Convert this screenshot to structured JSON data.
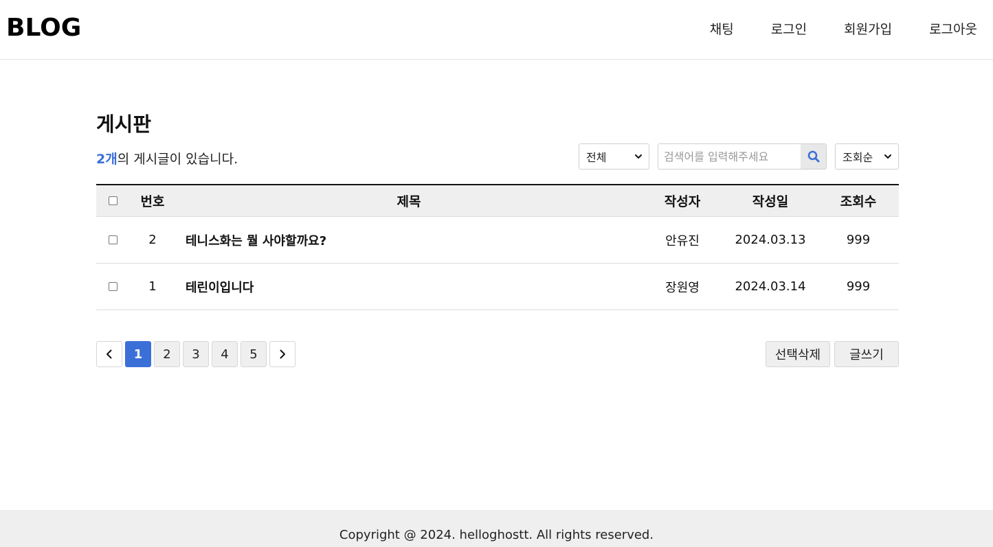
{
  "header": {
    "logo": "BLOG",
    "nav": [
      "채팅",
      "로그인",
      "회원가입",
      "로그아웃"
    ]
  },
  "board": {
    "title": "게시판",
    "count_num": "2개",
    "count_suffix": "의 게시글이 있습니다.",
    "category_select": "전체",
    "search_placeholder": "검색어를 입력해주세요",
    "sort_select": "조회순"
  },
  "table": {
    "headers": {
      "num": "번호",
      "title": "제목",
      "author": "작성자",
      "date": "작성일",
      "views": "조회수"
    },
    "rows": [
      {
        "num": "2",
        "title": "테니스화는 뭘 사야할까요?",
        "author": "안유진",
        "date": "2024.03.13",
        "views": "999"
      },
      {
        "num": "1",
        "title": "테린이입니다",
        "author": "장원영",
        "date": "2024.03.14",
        "views": "999"
      }
    ]
  },
  "pagination": {
    "pages": [
      "1",
      "2",
      "3",
      "4",
      "5"
    ],
    "current": "1"
  },
  "actions": {
    "delete_label": "선택삭제",
    "write_label": "글쓰기"
  },
  "footer": {
    "copyright": "Copyright @ 2024. helloghostt. All rights reserved."
  },
  "colors": {
    "accent": "#3b6fd8",
    "header_bg": "#efefef"
  }
}
